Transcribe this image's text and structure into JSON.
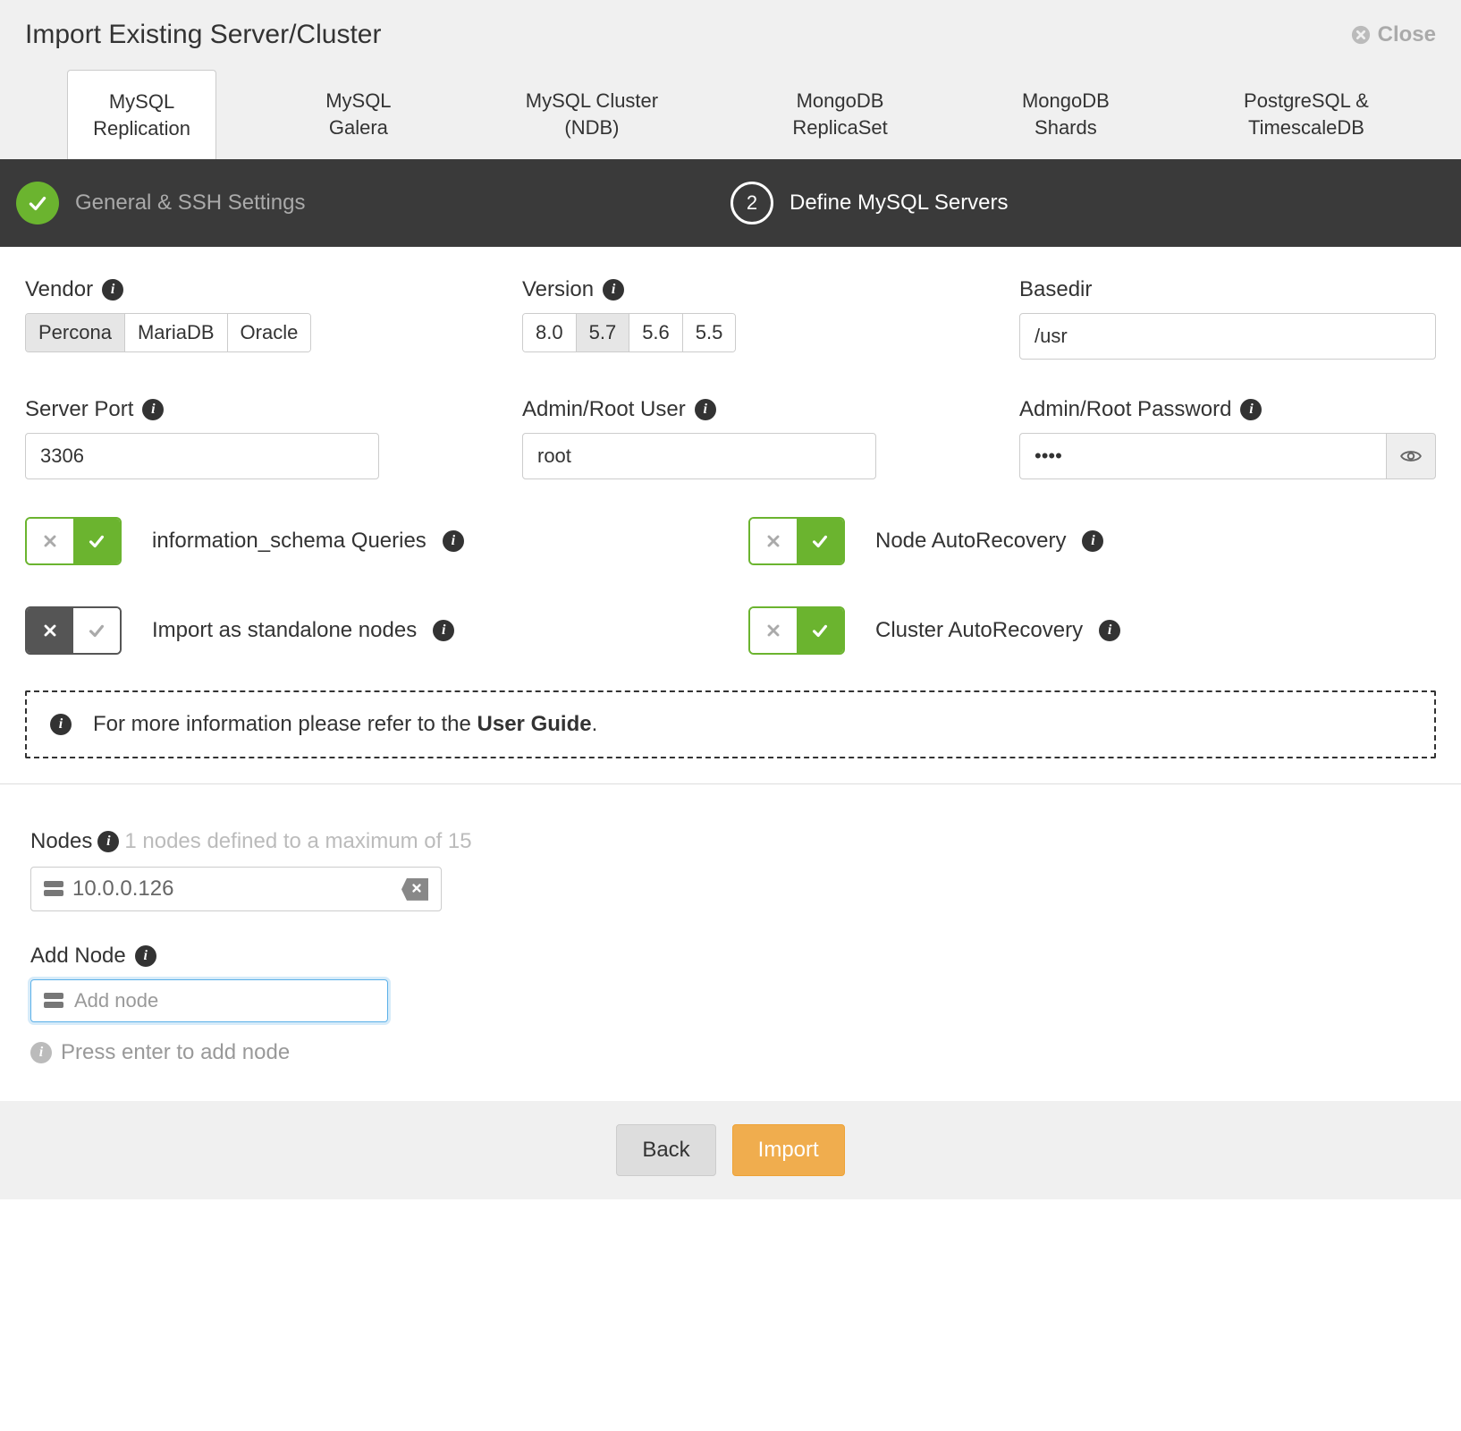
{
  "dialog": {
    "title": "Import Existing Server/Cluster",
    "close_label": "Close"
  },
  "tabs": [
    {
      "line1": "MySQL",
      "line2": "Replication",
      "active": true
    },
    {
      "line1": "MySQL",
      "line2": "Galera",
      "active": false
    },
    {
      "line1": "MySQL Cluster",
      "line2": "(NDB)",
      "active": false
    },
    {
      "line1": "MongoDB",
      "line2": "ReplicaSet",
      "active": false
    },
    {
      "line1": "MongoDB",
      "line2": "Shards",
      "active": false
    },
    {
      "line1": "PostgreSQL &",
      "line2": "TimescaleDB",
      "active": false
    }
  ],
  "wizard": {
    "step1_label": "General & SSH Settings",
    "step2_number": "2",
    "step2_label": "Define MySQL Servers"
  },
  "vendor": {
    "label": "Vendor",
    "options": [
      "Percona",
      "MariaDB",
      "Oracle"
    ],
    "selected": "Percona"
  },
  "version": {
    "label": "Version",
    "options": [
      "8.0",
      "5.7",
      "5.6",
      "5.5"
    ],
    "selected": "5.7"
  },
  "basedir": {
    "label": "Basedir",
    "value": "/usr"
  },
  "server_port": {
    "label": "Server Port",
    "value": "3306"
  },
  "admin_user": {
    "label": "Admin/Root User",
    "value": "root"
  },
  "admin_password": {
    "label": "Admin/Root Password",
    "value": "••••"
  },
  "toggles": {
    "info_schema": {
      "label": "information_schema Queries",
      "on": true
    },
    "node_autorecovery": {
      "label": "Node AutoRecovery",
      "on": true
    },
    "standalone": {
      "label": "Import as standalone nodes",
      "on": false
    },
    "cluster_autorecovery": {
      "label": "Cluster AutoRecovery",
      "on": true
    }
  },
  "note": {
    "prefix": "For more information please refer to the ",
    "bold": "User Guide",
    "suffix": "."
  },
  "nodes": {
    "label": "Nodes",
    "hint": "1 nodes defined to a maximum of 15",
    "items": [
      "10.0.0.126"
    ]
  },
  "add_node": {
    "label": "Add Node",
    "placeholder": "Add node",
    "hint": "Press enter to add node"
  },
  "footer": {
    "back": "Back",
    "import": "Import"
  }
}
